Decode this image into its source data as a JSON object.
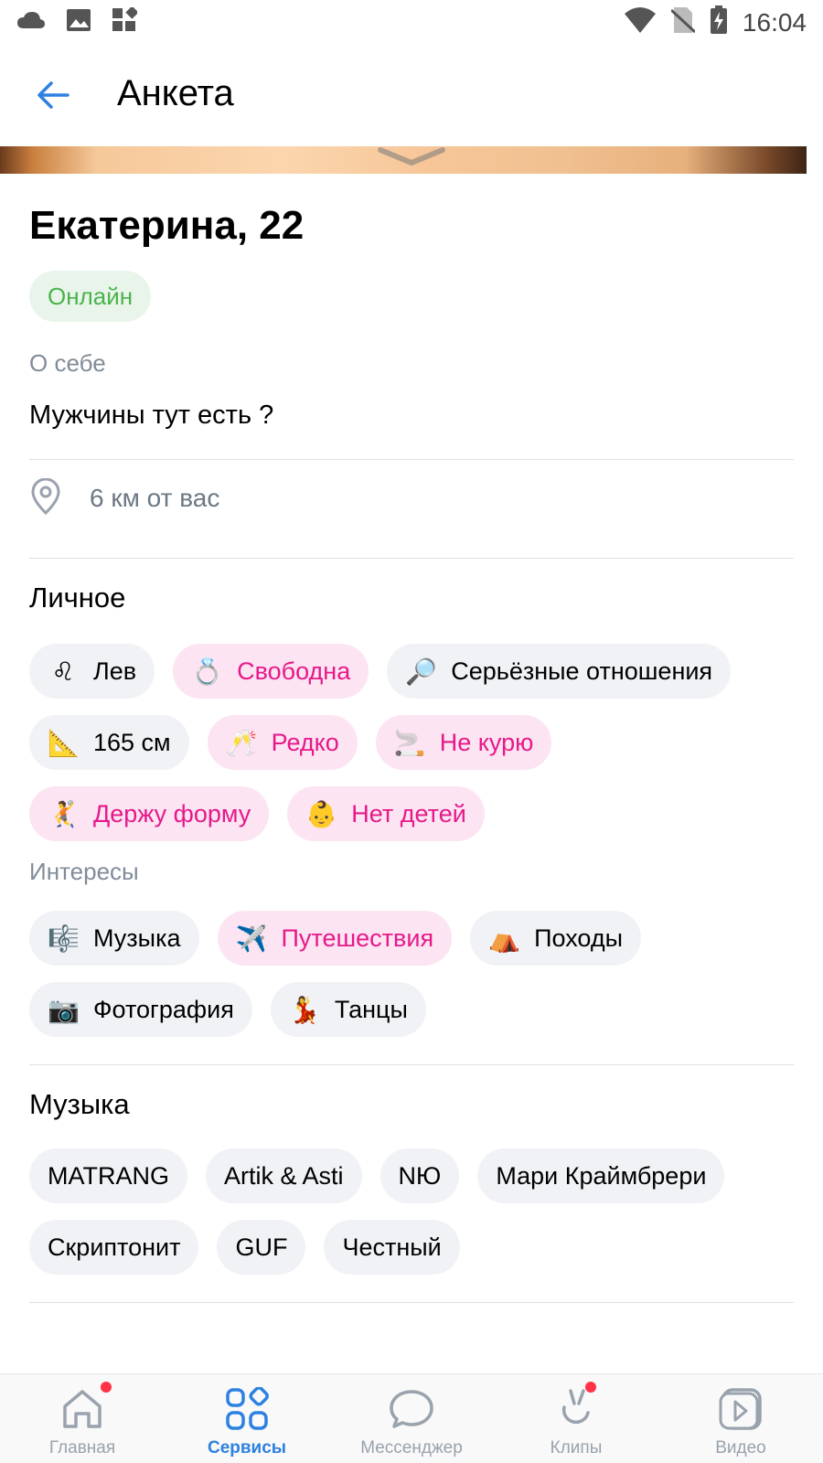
{
  "status_bar": {
    "time": "16:04",
    "left_icons": [
      "cloud-icon",
      "image-icon",
      "widgets-icon"
    ],
    "right_icons": [
      "wifi-icon",
      "no-sim-icon",
      "battery-charging-icon"
    ]
  },
  "app_bar": {
    "back_icon": "arrow-left-icon",
    "title": "Анкета"
  },
  "profile": {
    "name_age": "Екатерина, 22",
    "status": "Онлайн",
    "about_label": "О себе",
    "about_text": "Мужчины тут есть ?",
    "distance": "6 км от вас"
  },
  "personal": {
    "title": "Личное",
    "chips": [
      {
        "emoji": "♌",
        "label": "Лев",
        "highlight": false
      },
      {
        "emoji": "💍",
        "label": "Свободна",
        "highlight": true
      },
      {
        "emoji": "🔎",
        "label": "Серьёзные отношения",
        "highlight": false
      },
      {
        "emoji": "📐",
        "label": "165 см",
        "highlight": false
      },
      {
        "emoji": "🥂",
        "label": "Редко",
        "highlight": true
      },
      {
        "emoji": "🚬",
        "label": "Не курю",
        "highlight": true
      },
      {
        "emoji": "🤾",
        "label": "Держу форму",
        "highlight": true
      },
      {
        "emoji": "👶",
        "label": "Нет детей",
        "highlight": true
      }
    ]
  },
  "interests": {
    "title": "Интересы",
    "chips": [
      {
        "emoji": "🎼",
        "label": "Музыка",
        "highlight": false
      },
      {
        "emoji": "✈️",
        "label": "Путешествия",
        "highlight": true
      },
      {
        "emoji": "⛺",
        "label": "Походы",
        "highlight": false
      },
      {
        "emoji": "📷",
        "label": "Фотография",
        "highlight": false
      },
      {
        "emoji": "💃",
        "label": "Танцы",
        "highlight": false
      }
    ]
  },
  "music": {
    "title": "Музыка",
    "chips": [
      "MATRANG",
      "Artik & Asti",
      "NЮ",
      "Мари Краймбрери",
      "Скриптонит",
      "GUF",
      "Честный"
    ]
  },
  "bottom_nav": {
    "items": [
      {
        "label": "Главная",
        "icon": "home-icon",
        "badge": true
      },
      {
        "label": "Сервисы",
        "icon": "services-icon",
        "active": true
      },
      {
        "label": "Мессенджер",
        "icon": "messenger-icon"
      },
      {
        "label": "Клипы",
        "icon": "clips-icon",
        "badge": true
      },
      {
        "label": "Видео",
        "icon": "video-icon"
      }
    ]
  },
  "colors": {
    "accent": "#2d81e0",
    "online_green": "#4bb34b",
    "pink_text": "#e6198a",
    "pink_chip_bg": "#fce4f2",
    "chip_bg": "#f0f2f5",
    "secondary_text": "#818c99"
  }
}
